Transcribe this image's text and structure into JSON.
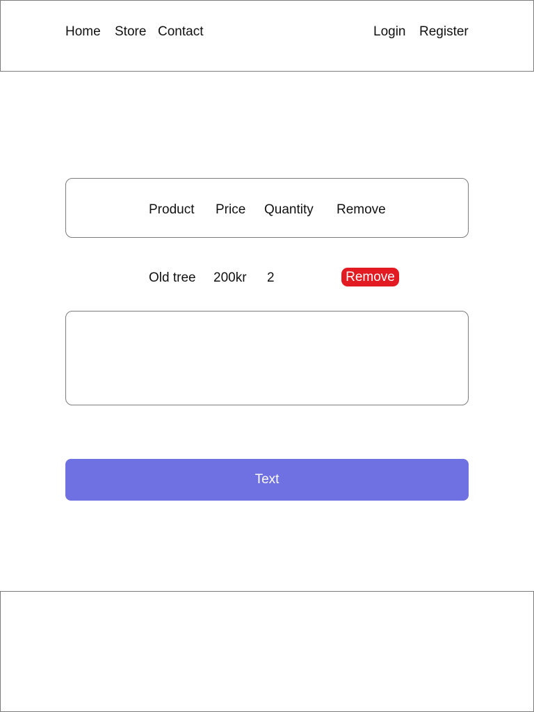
{
  "nav": {
    "left": [
      "Home",
      "Store",
      "Contact"
    ],
    "right": [
      "Login",
      "Register"
    ]
  },
  "cart": {
    "columns": [
      "Product",
      "Price",
      "Quantity",
      "Remove"
    ],
    "rows": [
      {
        "product": "Old tree",
        "price": "200kr",
        "quantity": "2",
        "remove_label": "Remove"
      }
    ]
  },
  "action_button": {
    "label": "Text"
  },
  "colors": {
    "remove_button": "#e21b23",
    "primary_button": "#6f70e2",
    "border": "#7a7a7a"
  }
}
